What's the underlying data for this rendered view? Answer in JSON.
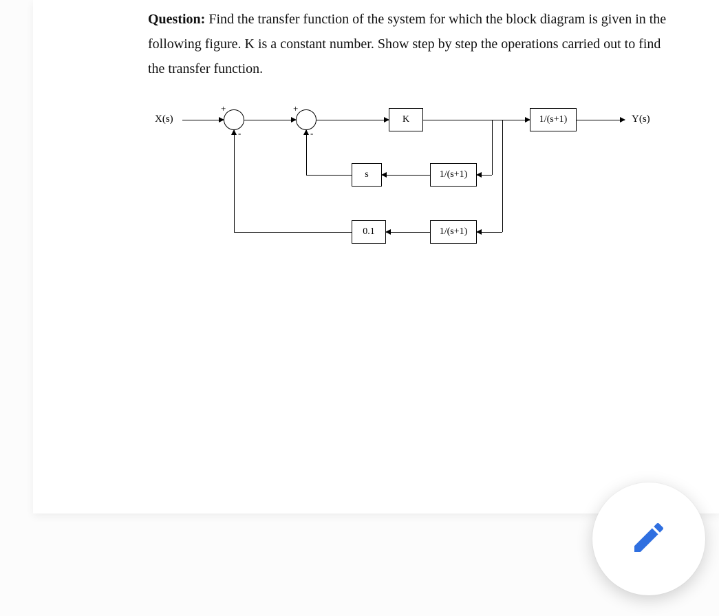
{
  "question": {
    "label": "Question:",
    "text": " Find the transfer function of the system for which the block diagram is given in the following figure. K is a constant number. Show step by step the operations carried out to find the transfer function."
  },
  "diagram": {
    "input_label": "X(s)",
    "output_label": "Y(s)",
    "signs": {
      "sum1_top": "+",
      "sum1_bottom": "-",
      "sum2_top": "+",
      "sum2_bottom": "-"
    },
    "blocks": {
      "forward_K": "K",
      "forward_1_over_s_plus_1": "1/(s+1)",
      "fb_inner_s": "s",
      "fb_inner_1_over_s_plus_1": "1/(s+1)",
      "fb_outer_0_1": "0.1",
      "fb_outer_1_over_s_plus_1": "1/(s+1)"
    }
  },
  "fab": {
    "icon": "edit-icon"
  }
}
